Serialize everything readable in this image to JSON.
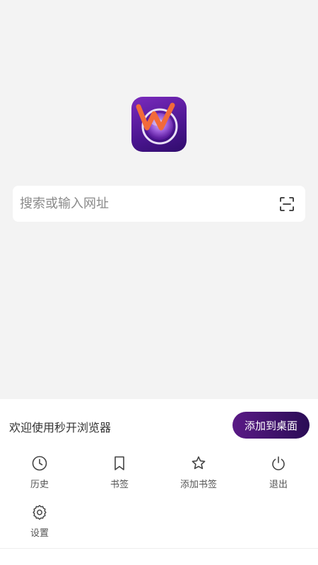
{
  "logo": {
    "icon": "browser-logo-icon",
    "brand_colors": [
      "#7b2bbd",
      "#2f0c6b",
      "#f06a3a"
    ]
  },
  "search": {
    "placeholder": "搜索或输入网址",
    "value": "",
    "scan_icon": "scan-icon"
  },
  "panel": {
    "welcome_text": "欢迎使用秒开浏览器",
    "add_to_desktop_label": "添加到桌面",
    "menu": [
      {
        "label": "历史",
        "icon": "clock-icon"
      },
      {
        "label": "书签",
        "icon": "bookmark-icon"
      },
      {
        "label": "添加书签",
        "icon": "star-icon"
      },
      {
        "label": "退出",
        "icon": "power-icon"
      },
      {
        "label": "设置",
        "icon": "gear-icon"
      }
    ]
  },
  "colors": {
    "accent": "#3f1370",
    "background": "#f3f3f3",
    "panel": "#ffffff"
  }
}
